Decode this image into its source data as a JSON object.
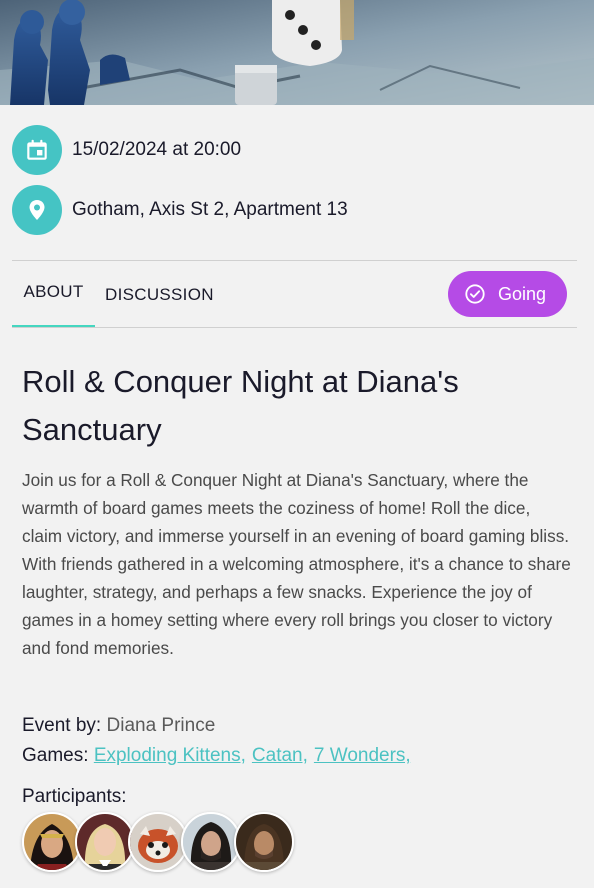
{
  "event": {
    "datetime": "15/02/2024 at 20:00",
    "location": "Gotham, Axis St 2, Apartment 13"
  },
  "tabs": [
    {
      "label": "ABOUT",
      "active": true
    },
    {
      "label": "DISCUSSION",
      "active": false
    }
  ],
  "rsvp": {
    "label": "Going"
  },
  "title": "Roll & Conquer Night at Diana's Sanctuary",
  "description": "Join us for a Roll & Conquer Night at Diana's Sanctuary, where the warmth of board games meets the coziness of home! Roll the dice, claim victory, and immerse yourself in an evening of board gaming bliss. With friends gathered in a welcoming atmosphere, it's a chance to share laughter, strategy, and perhaps a few snacks. Experience the joy of games in a homey setting where every roll brings you closer to victory and fond memories.",
  "host": {
    "label": "Event by:",
    "name": "Diana Prince"
  },
  "games": {
    "label": "Games:",
    "items": [
      "Exploding Kittens,",
      "Catan,",
      "7 Wonders,"
    ]
  },
  "participants": {
    "label": "Participants:",
    "avatars": [
      "wonder-woman",
      "sabrina",
      "red-panda",
      "jon-snow",
      "aragorn"
    ]
  },
  "colors": {
    "accent_teal": "#45c4c4",
    "going_purple": "#b54be6",
    "tab_indicator": "#45d6c0",
    "link": "#4cc2c2"
  },
  "icons": {
    "date": "calendar-icon",
    "location": "location-pin-icon",
    "rsvp": "check-circle-icon"
  }
}
